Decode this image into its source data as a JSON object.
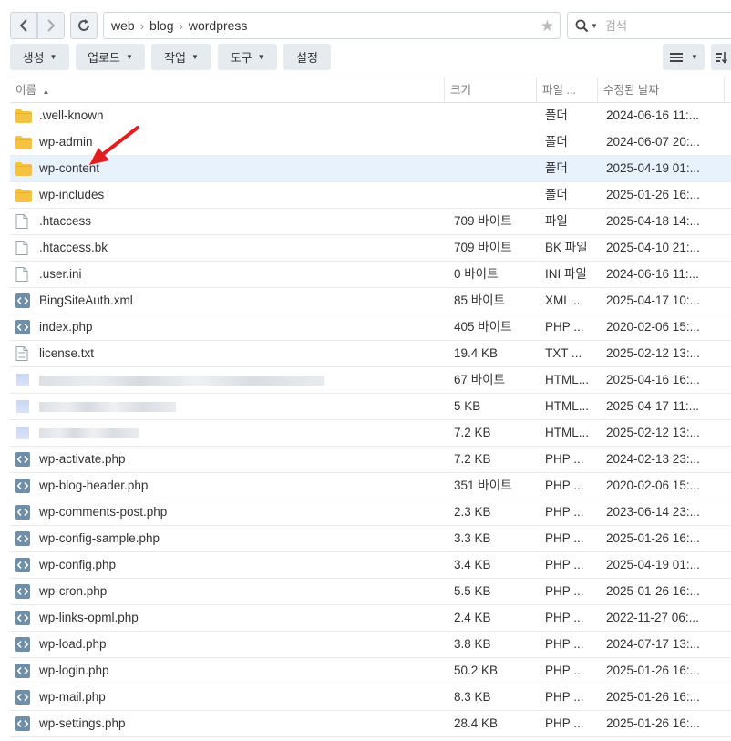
{
  "nav": {
    "path": [
      "web",
      "blog",
      "wordpress"
    ],
    "search_placeholder": "검색"
  },
  "toolbar": {
    "buttons": [
      {
        "label": "생성",
        "dropdown": true
      },
      {
        "label": "업로드",
        "dropdown": true
      },
      {
        "label": "작업",
        "dropdown": true
      },
      {
        "label": "도구",
        "dropdown": true
      },
      {
        "label": "설정",
        "dropdown": false
      }
    ]
  },
  "columns": {
    "name": "이름",
    "size": "크기",
    "type": "파일 ...",
    "modified": "수정된 날짜"
  },
  "colors": {
    "folder": "#f5c242",
    "selected_row": "#e8f2fd",
    "code_icon": "#6f8fa8",
    "arrow": "#e02020"
  },
  "files": [
    {
      "icon": "folder-icon",
      "name": ".well-known",
      "size": "",
      "type": "폴더",
      "modified": "2024-06-16 11:..."
    },
    {
      "icon": "folder-icon",
      "name": "wp-admin",
      "size": "",
      "type": "폴더",
      "modified": "2024-06-07 20:..."
    },
    {
      "icon": "folder-icon",
      "name": "wp-content",
      "size": "",
      "type": "폴더",
      "modified": "2025-04-19 01:...",
      "selected": true
    },
    {
      "icon": "folder-icon",
      "name": "wp-includes",
      "size": "",
      "type": "폴더",
      "modified": "2025-01-26 16:..."
    },
    {
      "icon": "file-icon",
      "name": ".htaccess",
      "size": "709 바이트",
      "type": "파일",
      "modified": "2025-04-18 14:..."
    },
    {
      "icon": "file-icon",
      "name": ".htaccess.bk",
      "size": "709 바이트",
      "type": "BK 파일",
      "modified": "2025-04-10 21:..."
    },
    {
      "icon": "file-icon",
      "name": ".user.ini",
      "size": "0 바이트",
      "type": "INI 파일",
      "modified": "2024-06-16 11:..."
    },
    {
      "icon": "code-file-icon",
      "name": "BingSiteAuth.xml",
      "size": "85 바이트",
      "type": "XML ...",
      "modified": "2025-04-17 10:..."
    },
    {
      "icon": "code-file-icon",
      "name": "index.php",
      "size": "405 바이트",
      "type": "PHP ...",
      "modified": "2020-02-06 15:..."
    },
    {
      "icon": "text-file-icon",
      "name": "license.txt",
      "size": "19.4 KB",
      "type": "TXT ...",
      "modified": "2025-02-12 13:..."
    },
    {
      "icon": "redacted-icon",
      "name": "",
      "size": "67 바이트",
      "type": "HTML...",
      "modified": "2025-04-16 16:...",
      "redacted": 0.92
    },
    {
      "icon": "redacted-icon",
      "name": "",
      "size": "5 KB",
      "type": "HTML...",
      "modified": "2025-04-17 11:...",
      "redacted": 0.44
    },
    {
      "icon": "redacted-icon",
      "name": "",
      "size": "7.2 KB",
      "type": "HTML...",
      "modified": "2025-02-12 13:...",
      "redacted": 0.32
    },
    {
      "icon": "code-file-icon",
      "name": "wp-activate.php",
      "size": "7.2 KB",
      "type": "PHP ...",
      "modified": "2024-02-13 23:..."
    },
    {
      "icon": "code-file-icon",
      "name": "wp-blog-header.php",
      "size": "351 바이트",
      "type": "PHP ...",
      "modified": "2020-02-06 15:..."
    },
    {
      "icon": "code-file-icon",
      "name": "wp-comments-post.php",
      "size": "2.3 KB",
      "type": "PHP ...",
      "modified": "2023-06-14 23:..."
    },
    {
      "icon": "code-file-icon",
      "name": "wp-config-sample.php",
      "size": "3.3 KB",
      "type": "PHP ...",
      "modified": "2025-01-26 16:..."
    },
    {
      "icon": "code-file-icon",
      "name": "wp-config.php",
      "size": "3.4 KB",
      "type": "PHP ...",
      "modified": "2025-04-19 01:..."
    },
    {
      "icon": "code-file-icon",
      "name": "wp-cron.php",
      "size": "5.5 KB",
      "type": "PHP ...",
      "modified": "2025-01-26 16:..."
    },
    {
      "icon": "code-file-icon",
      "name": "wp-links-opml.php",
      "size": "2.4 KB",
      "type": "PHP ...",
      "modified": "2022-11-27 06:..."
    },
    {
      "icon": "code-file-icon",
      "name": "wp-load.php",
      "size": "3.8 KB",
      "type": "PHP ...",
      "modified": "2024-07-17 13:..."
    },
    {
      "icon": "code-file-icon",
      "name": "wp-login.php",
      "size": "50.2 KB",
      "type": "PHP ...",
      "modified": "2025-01-26 16:..."
    },
    {
      "icon": "code-file-icon",
      "name": "wp-mail.php",
      "size": "8.3 KB",
      "type": "PHP ...",
      "modified": "2025-01-26 16:..."
    },
    {
      "icon": "code-file-icon",
      "name": "wp-settings.php",
      "size": "28.4 KB",
      "type": "PHP ...",
      "modified": "2025-01-26 16:..."
    }
  ]
}
